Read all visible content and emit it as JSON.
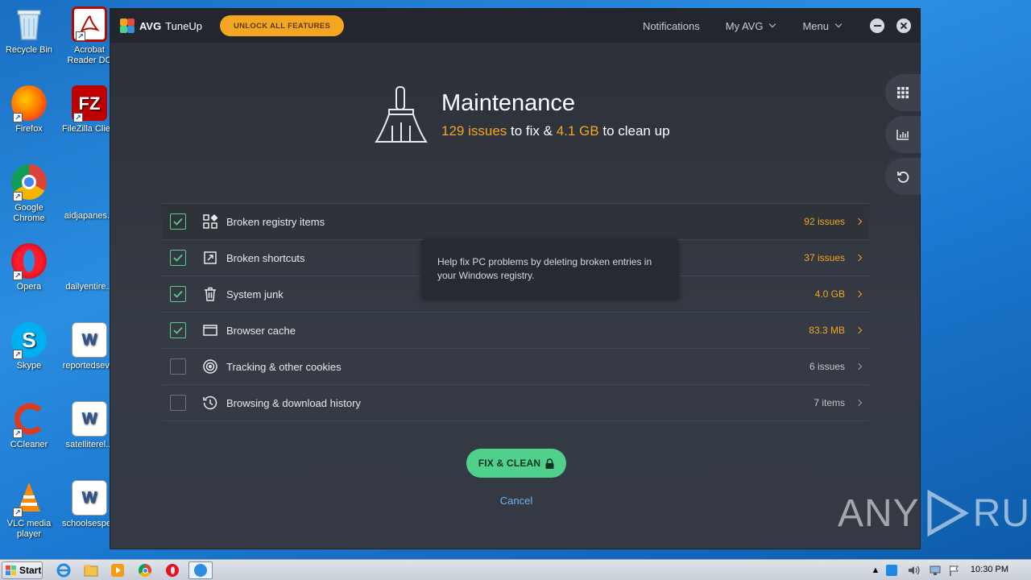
{
  "desktop": {
    "icons": [
      {
        "label": "Recycle Bin",
        "icon": "recycle-bin-icon"
      },
      {
        "label": "Acrobat Reader DC",
        "icon": "acrobat-icon"
      },
      {
        "label": "Firefox",
        "icon": "firefox-icon"
      },
      {
        "label": "FileZilla Client",
        "icon": "filezilla-icon"
      },
      {
        "label": "Google Chrome",
        "icon": "chrome-icon"
      },
      {
        "label": "aidjapanes...",
        "icon": "file-icon"
      },
      {
        "label": "Opera",
        "icon": "opera-icon"
      },
      {
        "label": "dailyentire...",
        "icon": "file-icon"
      },
      {
        "label": "Skype",
        "icon": "skype-icon"
      },
      {
        "label": "reportedsev...",
        "icon": "word-doc-icon"
      },
      {
        "label": "CCleaner",
        "icon": "ccleaner-icon"
      },
      {
        "label": "satelliterel...",
        "icon": "word-doc-icon"
      },
      {
        "label": "VLC media player",
        "icon": "vlc-icon"
      },
      {
        "label": "schoolsesper...",
        "icon": "word-doc-icon"
      }
    ]
  },
  "app": {
    "brand": "AVG",
    "product": "TuneUp",
    "unlock_label": "UNLOCK ALL FEATURES",
    "nav": {
      "notifications": "Notifications",
      "my_avg": "My AVG",
      "menu": "Menu"
    },
    "title": "Maintenance",
    "subtitle": {
      "issues": "129 issues",
      "mid": " to fix & ",
      "size": "4.1 GB",
      "end": " to clean up"
    },
    "rows": [
      {
        "label": "Broken registry items",
        "value": "92 issues",
        "checked": true,
        "value_color": "orange",
        "icon": "registry-icon"
      },
      {
        "label": "Broken shortcuts",
        "value": "37 issues",
        "checked": true,
        "value_color": "orange",
        "icon": "shortcut-icon"
      },
      {
        "label": "System junk",
        "value": "4.0 GB",
        "checked": true,
        "value_color": "orange",
        "icon": "trash-icon"
      },
      {
        "label": "Browser cache",
        "value": "83.3 MB",
        "checked": true,
        "value_color": "orange",
        "icon": "browser-icon"
      },
      {
        "label": "Tracking & other cookies",
        "value": "6 issues",
        "checked": false,
        "value_color": "gray",
        "icon": "target-icon"
      },
      {
        "label": "Browsing & download history",
        "value": "7 items",
        "checked": false,
        "value_color": "gray",
        "icon": "history-icon"
      }
    ],
    "tooltip": "Help fix PC problems by deleting broken entries in your Windows registry.",
    "fix_label": "FIX & CLEAN",
    "cancel_label": "Cancel",
    "colors": {
      "accent_orange": "#f4a623",
      "accent_green": "#4fd08b",
      "link_blue": "#6fb3f0"
    }
  },
  "taskbar": {
    "start_label": "Start",
    "clock": "10:30 PM"
  },
  "watermark": {
    "left": "ANY",
    "right": "RUN"
  }
}
